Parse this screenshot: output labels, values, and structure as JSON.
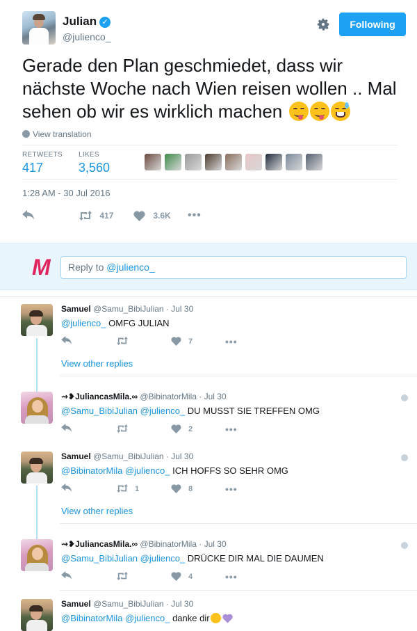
{
  "tweet": {
    "author_name": "Julian",
    "author_handle": "@julienco_",
    "follow_label": "Following",
    "text": "Gerade den Plan geschmiedet, dass wir nächste Woche nach Wien reisen wollen .. Mal sehen ob wir es wirklich machen",
    "view_translation": "View translation",
    "retweets_label": "RETWEETS",
    "retweets_count": "417",
    "likes_label": "LIKES",
    "likes_count": "3,560",
    "timestamp": "1:28 AM - 30 Jul 2016",
    "action_retweet_count": "417",
    "action_like_count": "3.6K",
    "liker_colors": [
      "#6b4a3e",
      "#3e8a4a",
      "#9a9a9a",
      "#4b3a2d",
      "#8a6d5a",
      "#e8c6c6",
      "#1f2b3a",
      "#7a8a9a",
      "#556070"
    ]
  },
  "reply_box": {
    "prefix": "Reply to ",
    "mention": "@julienco_"
  },
  "replies": [
    {
      "name": "Samuel",
      "handle": "@Samu_BibiJulian",
      "date": "Jul 30",
      "mentions": "@julienco_",
      "text": "OMFG JULIAN",
      "like_count": "7",
      "retweet_count": ""
    },
    {
      "name": "⇝❥JuliancasMila.∞",
      "handle": "@BibinatorMila",
      "date": "Jul 30",
      "mentions": "@Samu_BibiJulian @julienco_",
      "text": "DU MUSST SIE TREFFEN OMG",
      "like_count": "2",
      "retweet_count": ""
    },
    {
      "name": "Samuel",
      "handle": "@Samu_BibiJulian",
      "date": "Jul 30",
      "mentions": "@BibinatorMila @julienco_",
      "text": "ICH HOFFS SO SEHR OMG",
      "like_count": "8",
      "retweet_count": "1"
    },
    {
      "name": "⇝❥JuliancasMila.∞",
      "handle": "@BibinatorMila",
      "date": "Jul 30",
      "mentions": "@Samu_BibiJulian @julienco_",
      "text": "DRÜCKE DIR MAL DIE DAUMEN",
      "like_count": "4",
      "retweet_count": ""
    },
    {
      "name": "Samuel",
      "handle": "@Samu_BibiJulian",
      "date": "Jul 30",
      "mentions": "@BibinatorMila @julienco_",
      "text": "danke dir",
      "like_count": "",
      "retweet_count": ""
    }
  ],
  "view_other_replies": "View other replies",
  "dot_sep": " · "
}
